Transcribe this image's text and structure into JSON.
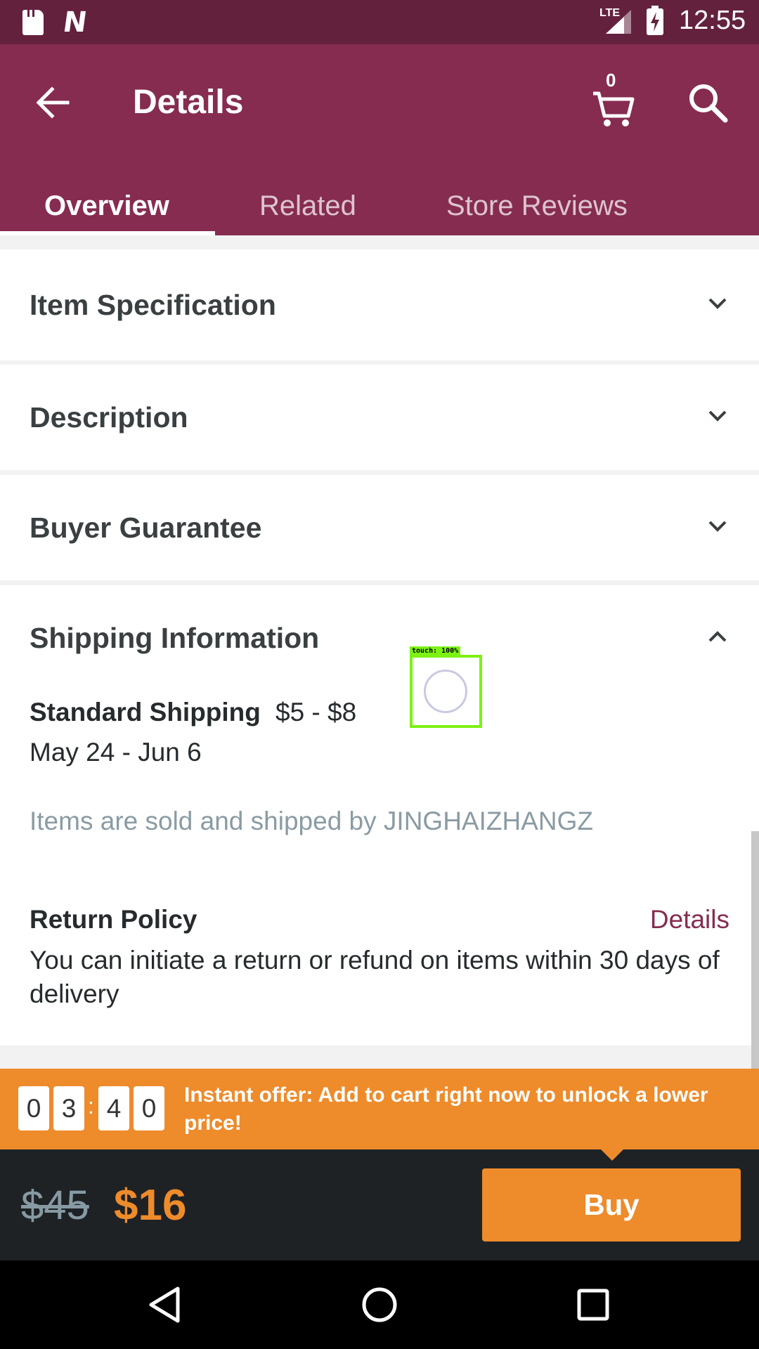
{
  "status_bar": {
    "time": "12:55",
    "network": "LTE",
    "icons": [
      "sd-card-icon",
      "n-logo-icon",
      "signal-icon",
      "battery-charging-icon"
    ]
  },
  "app_bar": {
    "title": "Details",
    "cart_count": "0",
    "icons": [
      "back-arrow-icon",
      "cart-icon",
      "search-icon"
    ]
  },
  "tabs": [
    {
      "label": "Overview",
      "active": true
    },
    {
      "label": "Related",
      "active": false
    },
    {
      "label": "Store Reviews",
      "active": false
    }
  ],
  "sections": [
    {
      "title": "Item Specification",
      "expanded": false
    },
    {
      "title": "Description",
      "expanded": false
    },
    {
      "title": "Buyer Guarantee",
      "expanded": false
    },
    {
      "title": "Shipping Information",
      "expanded": true
    }
  ],
  "shipping": {
    "method_label": "Standard Shipping",
    "price_range": "$5 - $8",
    "dates": "May 24 - Jun 6",
    "sold_by": "Items are sold and shipped by JINGHAIZHANGZ"
  },
  "return_policy": {
    "title": "Return Policy",
    "link": "Details",
    "text": "You can initiate a return or refund on items within 30 days of delivery"
  },
  "touch_overlay": {
    "label": "touch: 100%"
  },
  "offer": {
    "timer_digits": [
      "0",
      "3",
      "4",
      "0"
    ],
    "separator": ":",
    "text": "Instant offer: Add to cart right now to unlock a lower price!",
    "color": "#ee8b2b"
  },
  "price_bar": {
    "old_price": "$45",
    "new_price": "$16",
    "buy_label": "Buy"
  },
  "colors": {
    "status_bar": "#64213e",
    "app_bar": "#862c50",
    "accent": "#ee8b2b",
    "price_bar": "#1e2225"
  },
  "nav_bar": {
    "icons": [
      "nav-back-icon",
      "nav-home-icon",
      "nav-recent-icon"
    ]
  }
}
